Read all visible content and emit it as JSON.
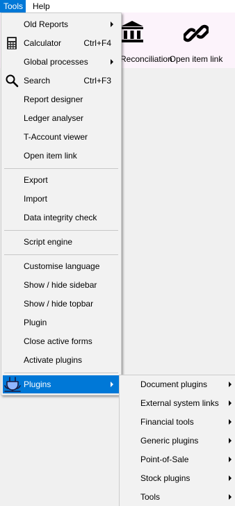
{
  "menubar": {
    "tools": "Tools",
    "help": "Help"
  },
  "toolbar": {
    "reconciliation": "Reconciliation",
    "open_item_link": "Open item link"
  },
  "tools_menu": {
    "old_reports": "Old Reports",
    "calculator": "Calculator",
    "calculator_shortcut": "Ctrl+F4",
    "global_processes": "Global processes",
    "search": "Search",
    "search_shortcut": "Ctrl+F3",
    "report_designer": "Report designer",
    "ledger_analyser": "Ledger analyser",
    "t_account_viewer": "T-Account viewer",
    "open_item_link": "Open item link",
    "export": "Export",
    "import": "Import",
    "data_integrity_check": "Data integrity check",
    "script_engine": "Script engine",
    "customise_language": "Customise language",
    "show_hide_sidebar": "Show / hide sidebar",
    "show_hide_topbar": "Show / hide topbar",
    "plugin": "Plugin",
    "close_active_forms": "Close active forms",
    "activate_plugins": "Activate plugins",
    "plugins": "Plugins"
  },
  "plugins_menu": {
    "document_plugins": "Document plugins",
    "external_system_links": "External system links",
    "financial_tools": "Financial tools",
    "generic_plugins": "Generic plugins",
    "point_of_sale": "Point-of-Sale",
    "stock_plugins": "Stock plugins",
    "tools": "Tools"
  },
  "colors": {
    "highlight": "#0078d7",
    "menu_bg": "#f2f2f2",
    "toolbar_bg": "#fcf3fb"
  }
}
